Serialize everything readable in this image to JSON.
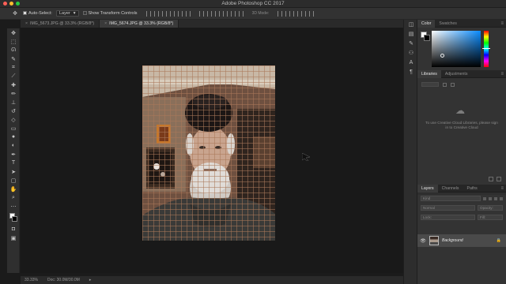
{
  "window": {
    "title": "Adobe Photoshop CC 2017"
  },
  "options_bar": {
    "auto_select_label": "Auto-Select:",
    "auto_select_target": "Layer",
    "transform_controls_label": "Show Transform Controls",
    "mode_3d_label": "3D Mode:"
  },
  "doc_tabs": [
    {
      "label": "IMG_5673.JPG @ 33.3% (RGB/8*)",
      "active": false
    },
    {
      "label": "IMG_5674.JPG @ 33.3% (RGB/8*)",
      "active": true
    }
  ],
  "status_bar": {
    "zoom": "33.33%",
    "doc_info": "Doc: 30.0M/30.0M"
  },
  "panels": {
    "color_tabs": [
      "Color",
      "Swatches"
    ],
    "library_tabs": [
      "Libraries",
      "Adjustments"
    ],
    "library_message": "To use Creative Cloud Libraries, please sign in to Creative Cloud",
    "layers_tabs": [
      "Layers",
      "Channels",
      "Paths"
    ],
    "layer_kind_placeholder": "Kind",
    "layer_blend_mode": "Normal",
    "layer_opacity_label": "Opacity:",
    "layer_lock_label": "Lock:",
    "layer_fill_label": "Fill:",
    "layers": [
      {
        "name": "Background",
        "locked": true,
        "visible": true
      }
    ]
  },
  "colors": {
    "foreground": "#ffffff",
    "background": "#000000",
    "accent": "#0a8cff"
  },
  "tools": [
    "move-tool",
    "artboard-tool",
    "marquee-tool",
    "lasso-tool",
    "quick-select-tool",
    "crop-tool",
    "eyedropper-tool",
    "healing-brush-tool",
    "brush-tool",
    "clone-stamp-tool",
    "history-brush-tool",
    "eraser-tool",
    "gradient-tool",
    "blur-tool",
    "dodge-tool",
    "pen-tool",
    "type-tool",
    "path-select-tool",
    "rectangle-tool",
    "hand-tool",
    "zoom-tool",
    "more-tools"
  ]
}
